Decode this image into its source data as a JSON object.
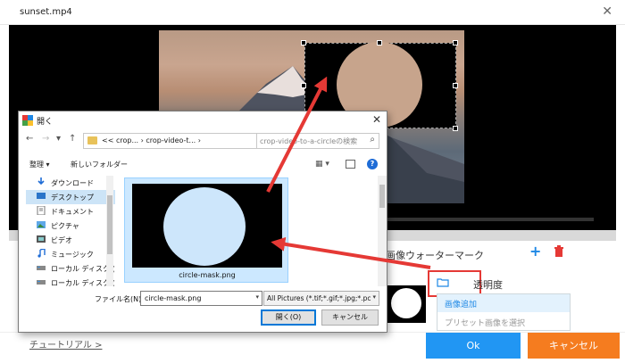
{
  "window": {
    "title": "sunset.mp4",
    "close_symbol": "✕"
  },
  "watermark_panel": {
    "title": "画像ウォーターマーク",
    "opacity_label": "透明度",
    "menu": {
      "add_image": "画像追加",
      "select_preset": "プリセット画像を選択"
    }
  },
  "footer": {
    "tutorial_link": "チュートリアル >",
    "ok_label": "Ok",
    "cancel_label": "キャンセル"
  },
  "dialog": {
    "title": "開く",
    "address": {
      "prefix": "<<",
      "segments": [
        "crop...",
        "crop-video-t..."
      ],
      "separator": "›"
    },
    "search_placeholder": "crop-video-to-a-circleの検索",
    "toolbar": {
      "organize": "整理 ▾",
      "new_folder": "新しいフォルダー"
    },
    "sidebar": [
      {
        "label": "ダウンロード",
        "icon": "download-icon"
      },
      {
        "label": "デスクトップ",
        "icon": "desktop-icon"
      },
      {
        "label": "ドキュメント",
        "icon": "document-icon"
      },
      {
        "label": "ピクチャ",
        "icon": "picture-icon"
      },
      {
        "label": "ビデオ",
        "icon": "video-icon"
      },
      {
        "label": "ミュージック",
        "icon": "music-icon"
      },
      {
        "label": "ローカル ディスク (C",
        "icon": "drive-icon"
      },
      {
        "label": "ローカル ディスク (C",
        "icon": "drive-icon"
      }
    ],
    "file": {
      "name": "circle-mask.png"
    },
    "filename_label": "ファイル名(N):",
    "filename_value": "circle-mask.png",
    "filetype_value": "All Pictures (*.tif;*.gif;*.jpg;*.pc",
    "open_label": "開く(O)",
    "cancel_label": "キャンセル"
  },
  "colors": {
    "accent_blue": "#2196f3",
    "accent_orange": "#f57c1f",
    "highlight_red": "#e53935"
  }
}
